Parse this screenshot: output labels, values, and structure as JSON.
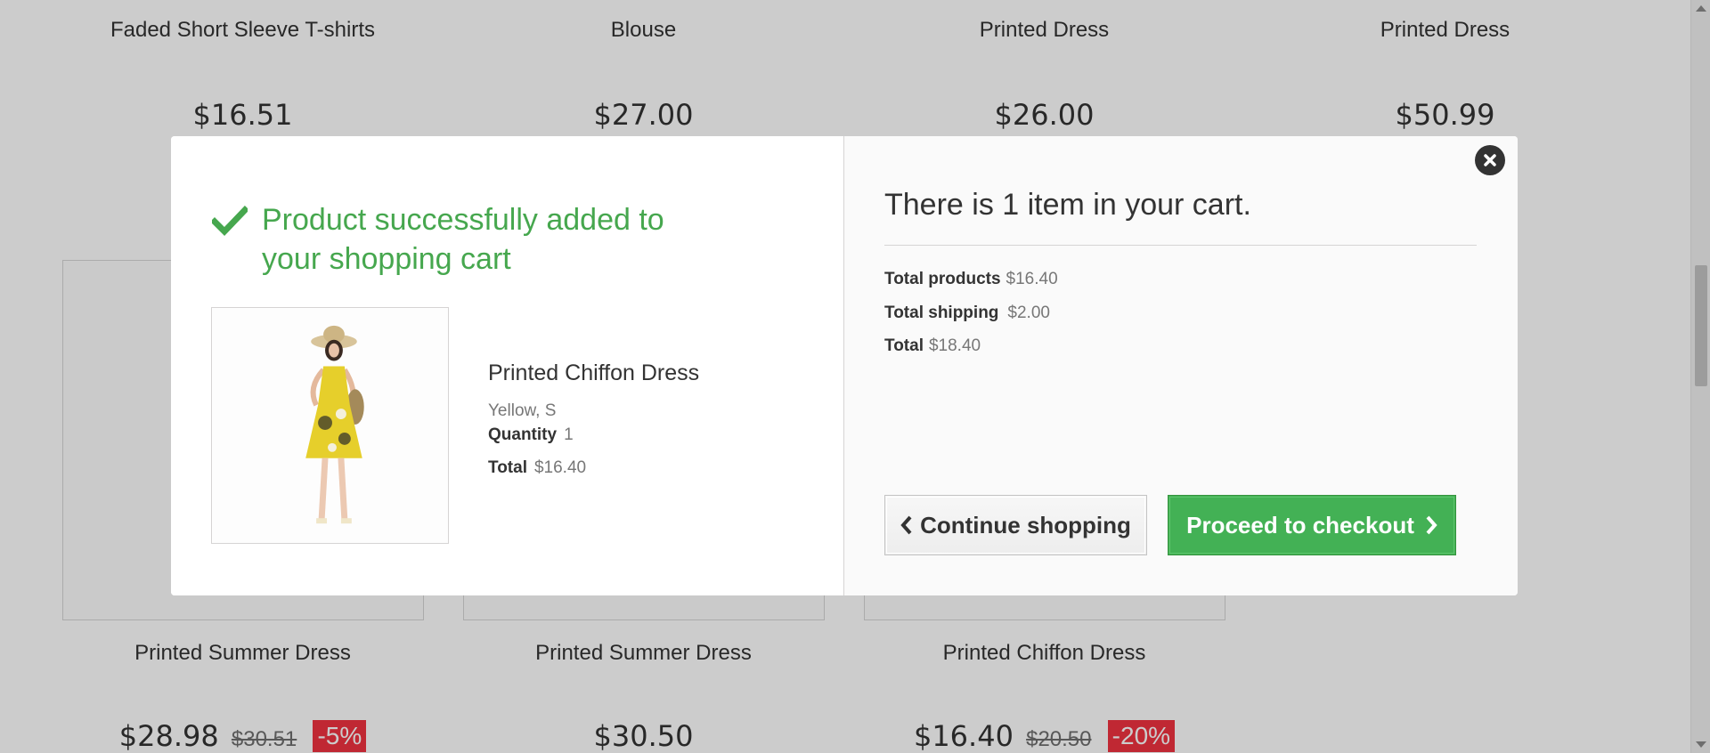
{
  "listing": {
    "row1": [
      {
        "name": "Faded Short Sleeve T-shirts",
        "price": "$16.51"
      },
      {
        "name": "Blouse",
        "price": "$27.00"
      },
      {
        "name": "Printed Dress",
        "price": "$26.00"
      },
      {
        "name": "Printed Dress",
        "price": "$50.99"
      }
    ],
    "row2": [
      {
        "name": "Printed Summer Dress",
        "price": "$28.98",
        "old_price": "$30.51",
        "discount": "-5%"
      },
      {
        "name": "Printed Summer Dress",
        "price": "$30.50"
      },
      {
        "name": "Printed Chiffon Dress",
        "price": "$16.40",
        "old_price": "$20.50",
        "discount": "-20%"
      }
    ]
  },
  "modal": {
    "success_message": "Product successfully added to your shopping cart",
    "product": {
      "name": "Printed Chiffon Dress",
      "attributes": "Yellow, S",
      "quantity_label": "Quantity",
      "quantity": "1",
      "total_label": "Total",
      "total": "$16.40"
    },
    "cart": {
      "title": "There is 1 item in your cart.",
      "total_products_label": "Total products",
      "total_products": "$16.40",
      "total_shipping_label": "Total shipping",
      "total_shipping": "$2.00",
      "total_label": "Total",
      "total": "$18.40"
    },
    "buttons": {
      "continue_label": "Continue shopping",
      "checkout_label": "Proceed to checkout"
    }
  },
  "icons": {
    "success": "check-icon",
    "close": "close-icon",
    "continue": "chevron-left-icon",
    "checkout": "chevron-right-icon"
  },
  "colors": {
    "success_green": "#46a74e",
    "checkout_green": "#43b155",
    "discount_red": "#f13340",
    "overlay": "rgba(0,0,0,0.2)"
  }
}
